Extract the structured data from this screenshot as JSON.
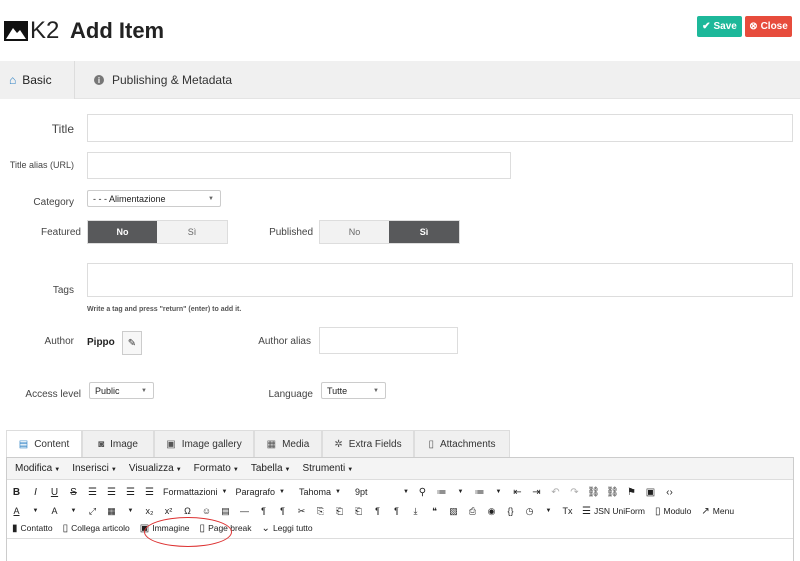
{
  "header": {
    "logo_text": "K2",
    "title": "Add Item",
    "save_label": "Save",
    "close_label": "Close",
    "save_color": "#1db89a",
    "close_color": "#e74c3c"
  },
  "main_tabs": [
    {
      "label": "Basic",
      "icon": "home-icon",
      "active": true
    },
    {
      "label": "Publishing & Metadata",
      "icon": "info-icon",
      "active": false
    }
  ],
  "form": {
    "title_label": "Title",
    "title_value": "",
    "alias_label": "Title alias (URL)",
    "alias_value": "",
    "category_label": "Category",
    "category_value": "- - - Alimentazione",
    "featured_label": "Featured",
    "featured_no": "No",
    "featured_yes": "Sì",
    "featured_selected": "No",
    "published_label": "Published",
    "published_no": "No",
    "published_yes": "Sì",
    "published_selected": "Sì",
    "tags_label": "Tags",
    "tags_hint": "Write a tag and press \"return\" (enter) to add it.",
    "author_label": "Author",
    "author_name": "Pippo",
    "author_alias_label": "Author alias",
    "author_alias_value": "",
    "access_label": "Access level",
    "access_value": "Public",
    "language_label": "Language",
    "language_value": "Tutte"
  },
  "content_tabs": [
    {
      "label": "Content",
      "icon": "document-icon",
      "active": true
    },
    {
      "label": "Image",
      "icon": "camera-icon",
      "active": false
    },
    {
      "label": "Image gallery",
      "icon": "image-icon",
      "active": false
    },
    {
      "label": "Media",
      "icon": "film-icon",
      "active": false
    },
    {
      "label": "Extra Fields",
      "icon": "gear-icon",
      "active": false
    },
    {
      "label": "Attachments",
      "icon": "file-icon",
      "active": false
    }
  ],
  "editor": {
    "menu": [
      "Modifica",
      "Inserisci",
      "Visualizza",
      "Formato",
      "Tabella",
      "Strumenti"
    ],
    "formats_label": "Formattazioni",
    "block_label": "Paragrafo",
    "font_label": "Tahoma",
    "size_label": "9pt",
    "jsn_label": "JSN UniForm",
    "module_label": "Modulo",
    "menu_label": "Menu",
    "contact_label": "Contatto",
    "link_article_label": "Collega articolo",
    "image_label": "Immagine",
    "pagebreak_label": "Page break",
    "readmore_label": "Leggi tutto"
  }
}
